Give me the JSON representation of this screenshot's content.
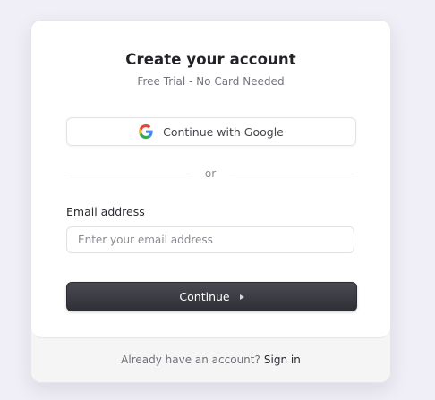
{
  "header": {
    "title": "Create your account",
    "subtitle": "Free Trial - No Card Needed"
  },
  "google_button": {
    "label": "Continue with Google",
    "icon": "google-icon"
  },
  "divider": {
    "text": "or"
  },
  "email": {
    "label": "Email address",
    "placeholder": "Enter your email address",
    "value": ""
  },
  "continue_button": {
    "label": "Continue",
    "icon": "arrow-right-icon"
  },
  "footer": {
    "prompt": "Already have an account?",
    "link_label": "Sign in"
  },
  "colors": {
    "background": "#f0eff7",
    "card": "#ffffff",
    "footer": "#f5f5f6",
    "primary_button": "#34343b",
    "google_blue": "#4285F4",
    "google_red": "#EA4335",
    "google_yellow": "#FBBC05",
    "google_green": "#34A853"
  }
}
